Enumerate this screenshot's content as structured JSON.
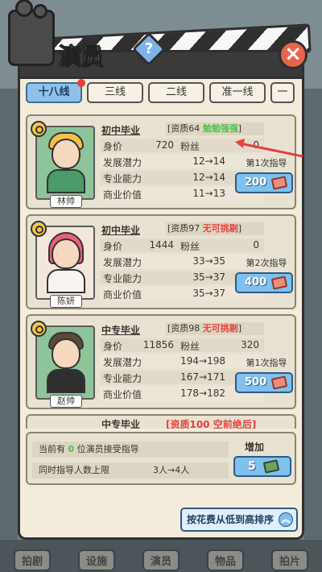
{
  "header": {
    "title": "演员",
    "help_symbol": "?",
    "close_symbol": "×"
  },
  "tabs": [
    {
      "label": "十八线",
      "active": true
    },
    {
      "label": "三线",
      "active": false
    },
    {
      "label": "二线",
      "active": false
    },
    {
      "label": "准一线",
      "active": false
    },
    {
      "label": "一",
      "active": false
    }
  ],
  "stat_labels": {
    "price": "身价",
    "fans": "粉丝",
    "potential": "发展潜力",
    "ability": "专业能力",
    "commercial": "商业价值"
  },
  "actors": [
    {
      "name": "林帅",
      "education": "初中毕业",
      "quality_prefix": "[资质64",
      "quality_tag": "勉勉强强",
      "quality_suffix": "]",
      "quality_color": "#4fc24a",
      "price": "720",
      "fans": "0",
      "potential": "12→14",
      "ability": "12→14",
      "commercial": "11→13",
      "guide_text": "第1次指导",
      "guide_cost": "200",
      "portrait_bg": "#8fc39a",
      "hair_color": "#f4c04a",
      "body_color": "#4a9a6a"
    },
    {
      "name": "陈妍",
      "education": "初中毕业",
      "quality_prefix": "[资质97",
      "quality_tag": "无可挑剔",
      "quality_suffix": "]",
      "quality_color": "#e8413a",
      "price": "1444",
      "fans": "0",
      "potential": "33→35",
      "ability": "35→37",
      "commercial": "35→37",
      "guide_text": "第2次指导",
      "guide_cost": "400",
      "portrait_bg": "#f3e7dc",
      "hair_color": "#e9607a",
      "body_color": "#f8f4f0"
    },
    {
      "name": "赵帅",
      "education": "中专毕业",
      "quality_prefix": "[资质98",
      "quality_tag": "无可挑剔",
      "quality_suffix": "]",
      "quality_color": "#e8413a",
      "price": "11856",
      "fans": "320",
      "potential": "194→198",
      "ability": "167→171",
      "commercial": "178→182",
      "guide_text": "第1次指导",
      "guide_cost": "500",
      "portrait_bg": "#8fc39a",
      "hair_color": "#5a4a3a",
      "body_color": "#2f2f2f"
    }
  ],
  "partial_card": {
    "education": "中专毕业",
    "quality": "[资质100 空前绝后]"
  },
  "summary": {
    "line1_prefix": "当前有 ",
    "line1_count": "0",
    "line1_suffix": " 位演员接受指导",
    "line2": "同时指导人数上限",
    "line2_values": "3人→4人",
    "add_label": "增加",
    "add_cost": "5"
  },
  "sort_button": "按花费从低到高排序",
  "bottom_nav": [
    "拍剧",
    "设施",
    "演员",
    "物品",
    "拍片"
  ]
}
